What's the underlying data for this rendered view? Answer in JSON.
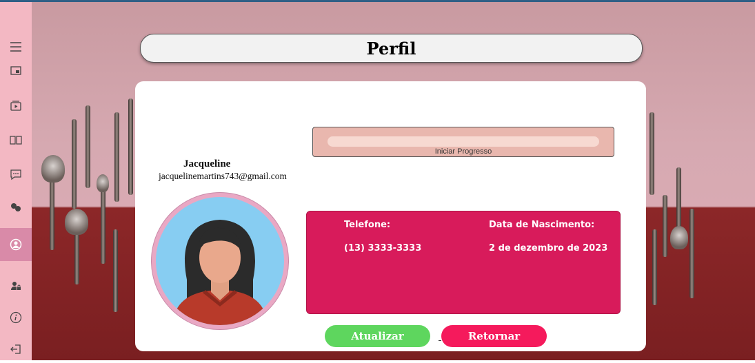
{
  "header": {
    "title": "Perfil"
  },
  "sidebar": {
    "items": [
      {
        "name": "menu-icon"
      },
      {
        "name": "dashboard-icon"
      },
      {
        "name": "video-icon"
      },
      {
        "name": "book-icon"
      },
      {
        "name": "chat-icon"
      },
      {
        "name": "community-icon"
      },
      {
        "name": "profile-icon",
        "active": true
      },
      {
        "name": "user-lock-icon"
      },
      {
        "name": "info-icon"
      },
      {
        "name": "logout-icon"
      }
    ]
  },
  "profile": {
    "name": "Jacqueline",
    "email": "jacquelinemartins743@gmail.com",
    "progress_label": "Iniciar Progresso",
    "progress_value": 0,
    "phone_label": "Telefone:",
    "phone_value": "(13) 3333-3333",
    "birth_label": "Data de Nascimento:",
    "birth_value": "2 de dezembro de 2023"
  },
  "buttons": {
    "update": "Atualizar",
    "return": "Retornar"
  },
  "colors": {
    "sidebar": "#f3b8c3",
    "info_box": "#d81b5b",
    "update_button": "#5ed65e",
    "return_button": "#f51a5c",
    "progress_box": "#e9b7ae"
  }
}
